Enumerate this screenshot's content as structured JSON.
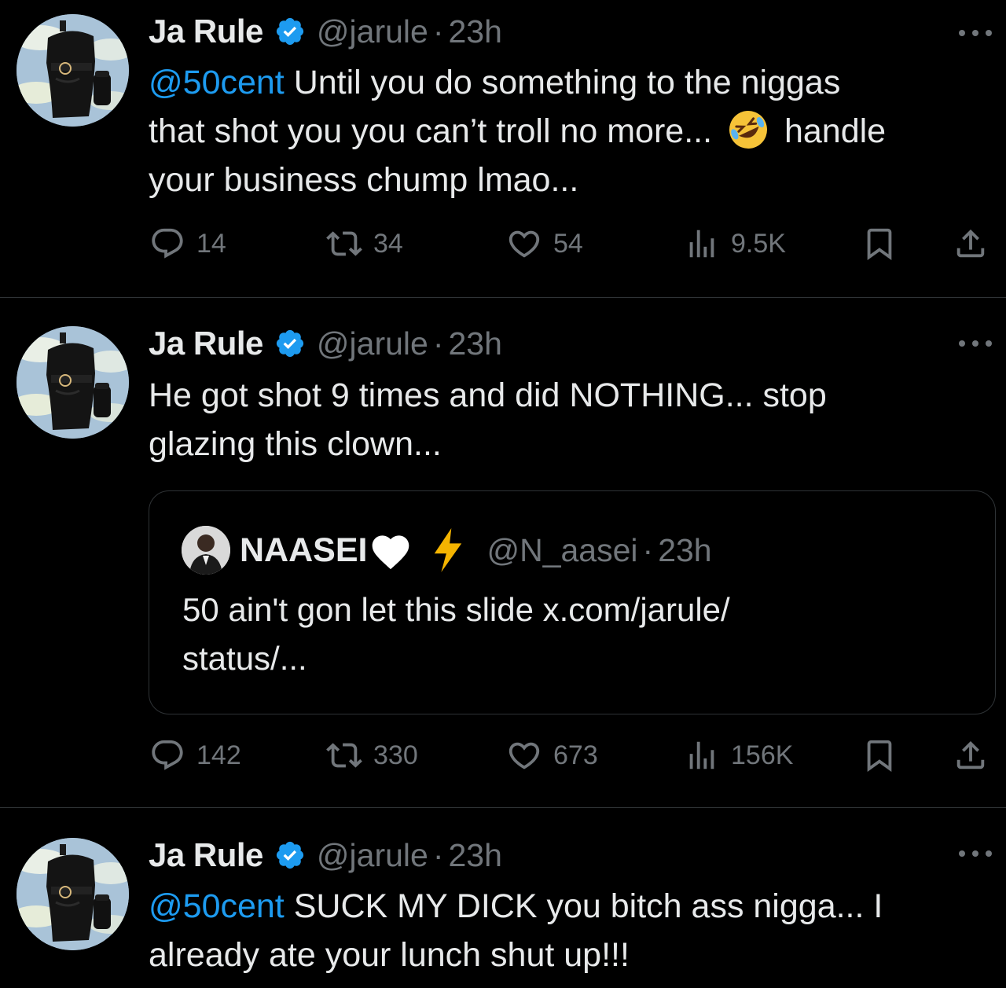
{
  "tweets": [
    {
      "author_name": "Ja Rule",
      "handle": "@jarule",
      "separator": "·",
      "time": "23h",
      "mention": "@50cent",
      "text_line1": " Until you do something to the niggas",
      "text_line2a": "that shot you you can’t troll no more...",
      "emoji": "rolling-on-floor-laughing",
      "text_line2b": "handle",
      "text_line3": "your business chump lmao...",
      "replies": "14",
      "reposts": "34",
      "likes": "54",
      "views": "9.5K"
    },
    {
      "author_name": "Ja Rule",
      "handle": "@jarule",
      "separator": "·",
      "time": "23h",
      "text_line1": "He got shot 9 times and did NOTHING... stop",
      "text_line2": "glazing this clown...",
      "quote": {
        "name": "NAASEI",
        "name_emojis": [
          "white-heart",
          "high-voltage"
        ],
        "handle": "@N_aasei",
        "separator": "·",
        "time": "23h",
        "text_line1": "50 ain't gon let this slide x.com/jarule/",
        "text_line2": "status/..."
      },
      "replies": "142",
      "reposts": "330",
      "likes": "673",
      "views": "156K"
    },
    {
      "author_name": "Ja Rule",
      "handle": "@jarule",
      "separator": "·",
      "time": "23h",
      "mention": "@50cent",
      "text_line1": " SUCK MY DICK you bitch ass nigga... I",
      "text_line2": "already ate your lunch shut up!!!"
    }
  ],
  "colors": {
    "background": "#000000",
    "text": "#e7e9ea",
    "muted": "#71767b",
    "accent": "#1d9bf0",
    "divider": "#2f3336"
  }
}
